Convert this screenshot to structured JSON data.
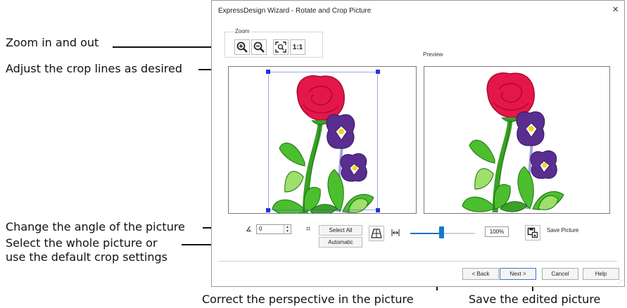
{
  "callouts": {
    "zoom": "Zoom in and out",
    "crop_lines": "Adjust the crop lines as desired",
    "angle": "Change the angle of the picture",
    "select_line1": "Select the whole picture or",
    "select_line2": "use the default crop settings",
    "perspective": "Correct the perspective in the picture",
    "save": "Save the edited picture"
  },
  "dialog": {
    "title": "ExpressDesign Wizard - Rotate and Crop Picture",
    "close": "×"
  },
  "zoom": {
    "group_label": "Zoom",
    "one_to_one": "1:1"
  },
  "preview_label": "Preview",
  "angle": {
    "value": "0"
  },
  "crop": {
    "select_all": "Select All",
    "automatic": "Automatic"
  },
  "zoom_percent": "100%",
  "slider": {
    "level_fraction": 0.48
  },
  "save_picture": "Save Picture",
  "buttons": {
    "back": "< Back",
    "next": "Next >",
    "cancel": "Cancel",
    "help": "Help"
  },
  "colors": {
    "rose": "#e5164a",
    "rose_dark": "#a80c2e",
    "violet": "#5a2d91",
    "leaf": "#4cbf2e",
    "leaf_light": "#9ee06a",
    "leaf_dark": "#1d6f14",
    "accent_blue": "#1478d0",
    "crop_handle": "#2233dd"
  }
}
